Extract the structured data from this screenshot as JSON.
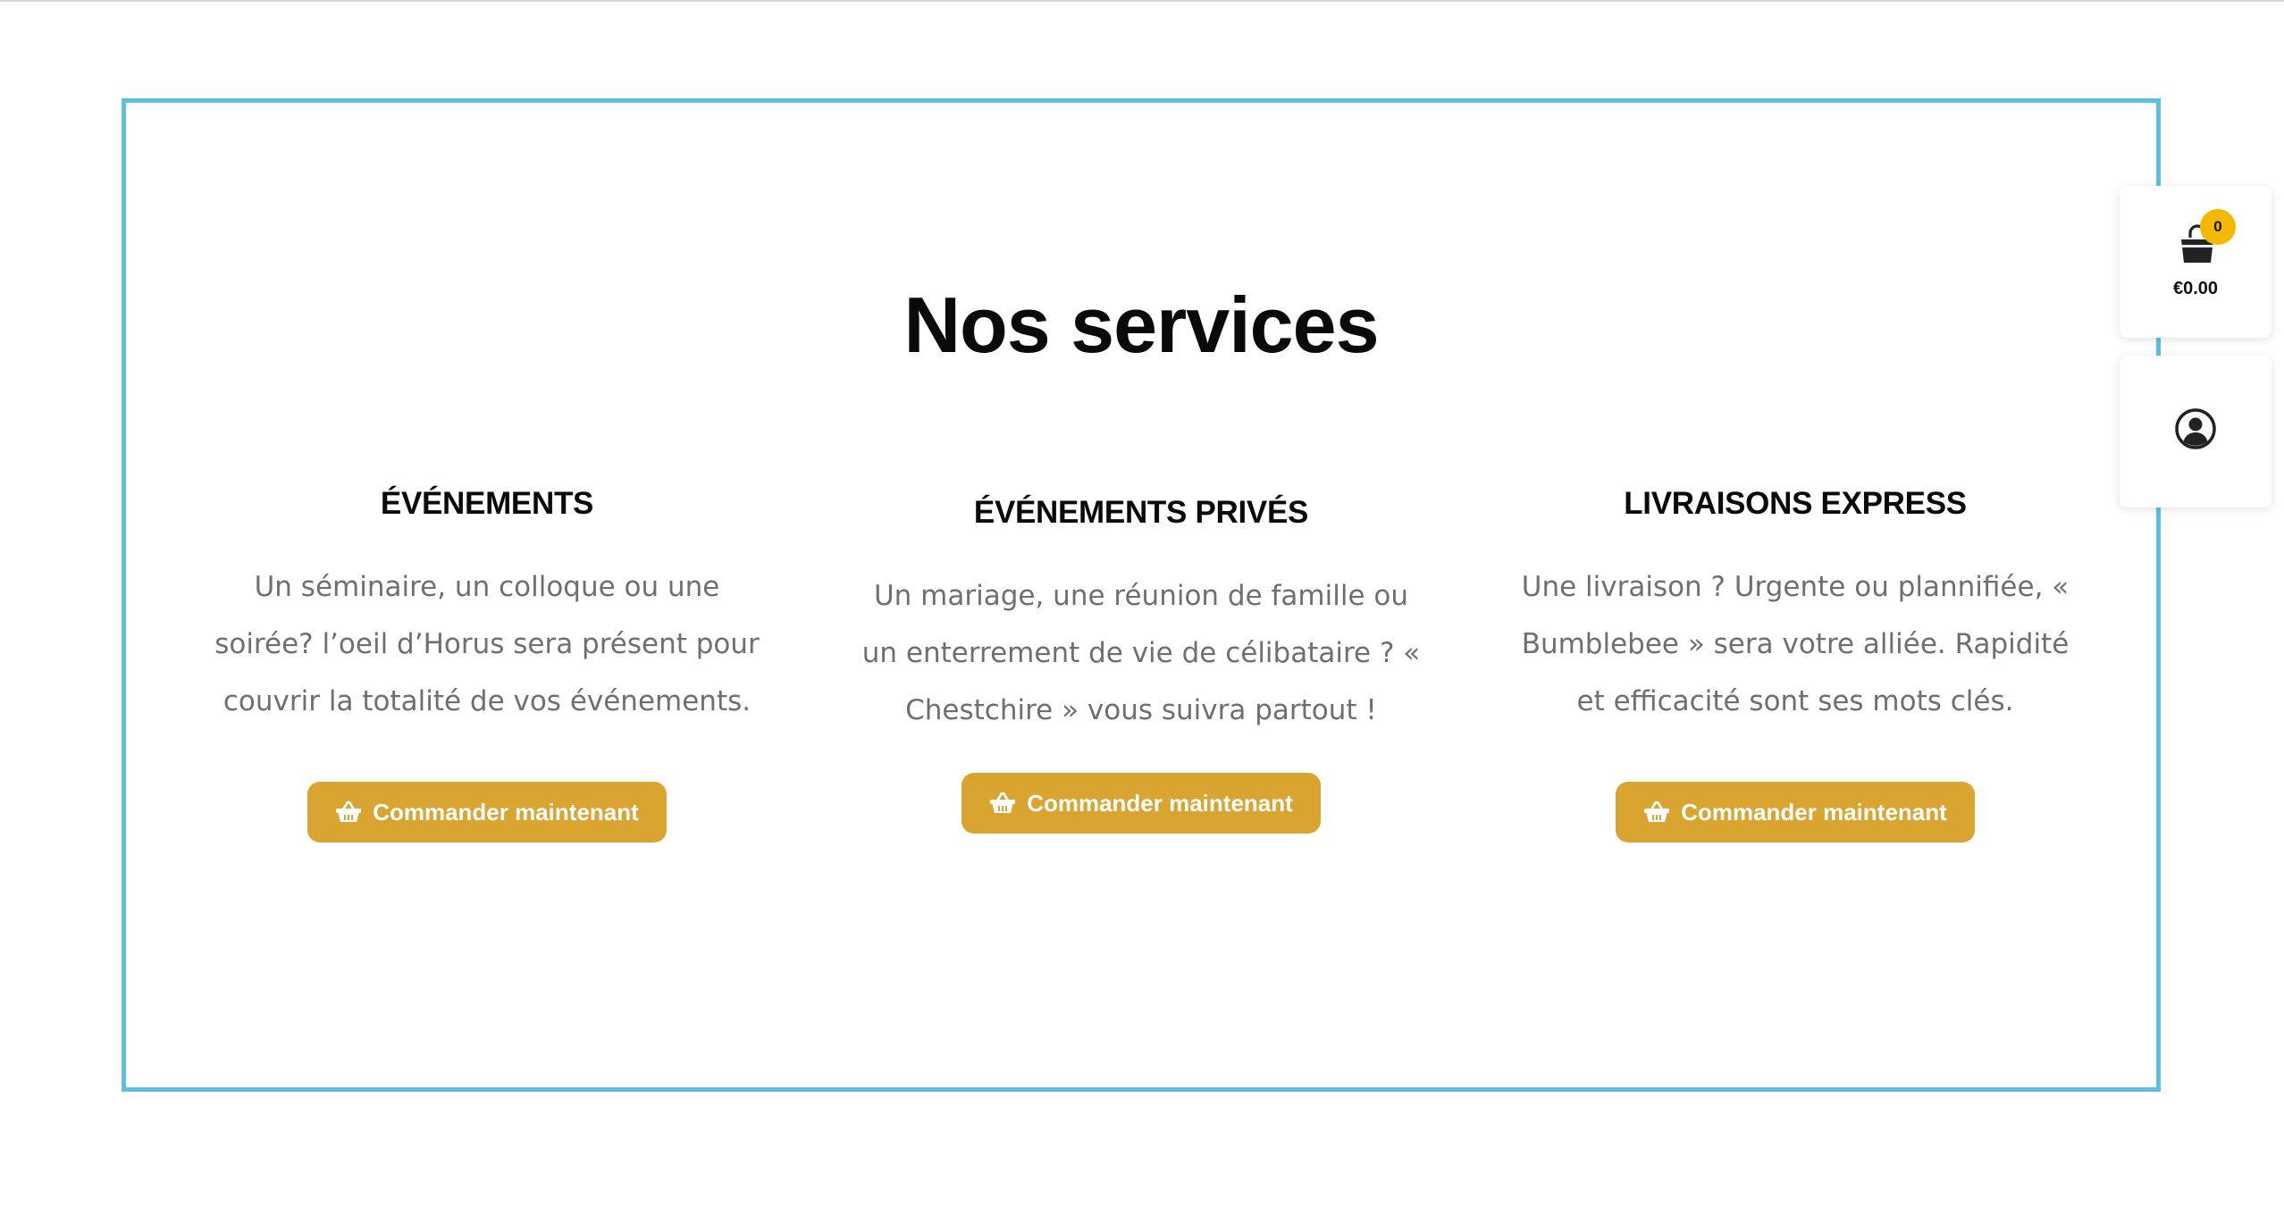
{
  "section": {
    "title": "Nos services"
  },
  "services": [
    {
      "heading": "ÉVÉNEMENTS",
      "lines": [
        "Un séminaire, un colloque ou une",
        "soirée? l’oeil d’Horus sera présent pour",
        "couvrir la totalité de vos événements."
      ],
      "button_label": "Commander maintenant",
      "button_icon": "basket-icon"
    },
    {
      "heading": "ÉVÉNEMENTS PRIVÉS",
      "lines": [
        "Un mariage, une réunion de famille ou",
        "un enterrement de vie de célibataire ? «",
        "Chestchire » vous suivra partout !"
      ],
      "button_label": "Commander maintenant",
      "button_icon": "basket-icon"
    },
    {
      "heading": "LIVRAISONS EXPRESS",
      "lines": [
        "Une livraison ? Urgente ou plannifiée, «",
        "Bumblebee » sera votre alliée. Rapidité",
        "et efficacité sont ses mots clés."
      ],
      "button_label": "Commander maintenant",
      "button_icon": "basket-icon"
    }
  ],
  "cart_widget": {
    "count": "0",
    "total": "€0.00",
    "icon": "shopping-bag-icon"
  },
  "account_widget": {
    "icon": "user-circle-icon"
  },
  "colors": {
    "frame_border": "#5ebfe0",
    "button_bg": "#d9a430",
    "badge_bg": "#f5b800",
    "body_text": "#6f6f6f",
    "heading_text": "#0a0a0a"
  }
}
